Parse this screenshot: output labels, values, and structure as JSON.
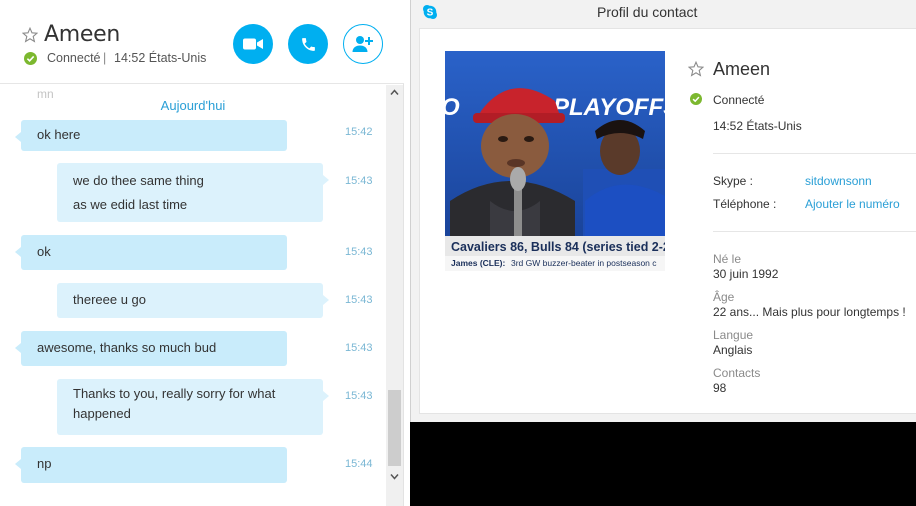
{
  "chat_header": {
    "contact_name": "Ameen",
    "status": "Connecté",
    "separator": "|",
    "local_time": "14:52 États-Unis"
  },
  "conversation": {
    "faded_previous": "mn",
    "day_divider": "Aujourd'hui",
    "messages": [
      {
        "direction": "in",
        "lines": [
          "ok here"
        ],
        "time": "15:42"
      },
      {
        "direction": "out",
        "lines": [
          "we do thee same thing",
          "as we edid last time"
        ],
        "time": "15:43"
      },
      {
        "direction": "in",
        "lines": [
          "ok"
        ],
        "time": "15:43"
      },
      {
        "direction": "out",
        "lines": [
          "thereee u go"
        ],
        "time": "15:43"
      },
      {
        "direction": "in",
        "lines": [
          "awesome, thanks so much bud"
        ],
        "time": "15:43"
      },
      {
        "direction": "out",
        "lines": [
          "Thanks to you, really sorry for what",
          "happened"
        ],
        "time": "15:43"
      },
      {
        "direction": "in",
        "lines": [
          "np"
        ],
        "time": "15:44"
      }
    ]
  },
  "profile": {
    "window_title": "Profil du contact",
    "name": "Ameen",
    "status": "Connecté",
    "local_time": "14:52 États-Unis",
    "skype_label": "Skype :",
    "skype_value": "sitdownsonn",
    "phone_label": "Téléphone :",
    "phone_value": "Ajouter le numéro",
    "born_label": "Né le",
    "born_value": "30 juin 1992",
    "age_label": "Âge",
    "age_value": "22 ans... Mais plus pour longtemps !",
    "language_label": "Langue",
    "language_value": "Anglais",
    "contacts_label": "Contacts",
    "contacts_value": "98",
    "photo_text": {
      "banner": "PLAYOFFS",
      "banner_left": "O",
      "ticker_main": "Cavaliers 86, Bulls 84 (series tied 2-2",
      "ticker_sub_name": "James (CLE):",
      "ticker_sub_text": "3rd GW buzzer-beater in postseason c"
    }
  },
  "colors": {
    "accent": "#00aff0",
    "link": "#2a9fd6",
    "bubble_in": "#c9ecfb",
    "bubble_out": "#dcf2fc",
    "online": "#7cb82f"
  },
  "icons": {
    "video": "video-camera-icon",
    "call": "phone-icon",
    "add": "add-contact-icon",
    "favorite": "star-outline-icon",
    "presence": "online-check-icon",
    "app": "skype-logo-icon"
  }
}
